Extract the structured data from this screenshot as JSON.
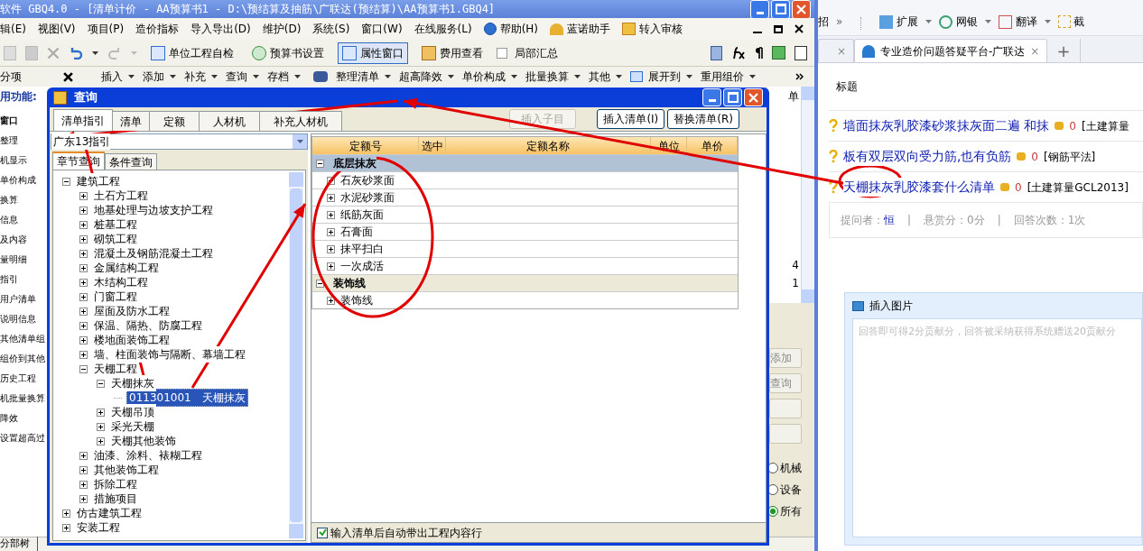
{
  "app": {
    "title": "软件 GBQ4.0 - [清单计价 - AA预算书1 - D:\\预结算及抽筋\\广联达(预结算)\\AA预算书1.GBQ4]",
    "menu": [
      "辑(E)",
      "视图(V)",
      "项目(P)",
      "造价指标",
      "导入导出(D)",
      "维护(D)",
      "系统(S)",
      "窗口(W)",
      "在线服务(L)",
      "帮助(H)",
      "蓝诺助手",
      "转入审核"
    ],
    "toolbar": [
      {
        "kind": "button",
        "label": "单位工程自检",
        "pressed": false
      },
      {
        "kind": "button",
        "label": "预算书设置",
        "pressed": false
      },
      {
        "kind": "button",
        "label": "属性窗口",
        "pressed": true
      },
      {
        "kind": "button",
        "label": "费用查看",
        "pressed": false
      },
      {
        "kind": "checkbox",
        "label": "局部汇总",
        "checked": false
      }
    ],
    "panel_tab": "分项",
    "toolbar2": [
      "插入",
      "添加",
      "补充",
      "查询",
      "存档",
      "整理清单",
      "超高降效",
      "单价构成",
      "批量换算",
      "其他",
      "展开到",
      "重用组价"
    ],
    "sidebar": {
      "heading": "用功能:",
      "items": [
        {
          "label": "窗口",
          "bold": true
        },
        {
          "label": "整理",
          "bold": false
        },
        {
          "label": "机显示",
          "bold": false
        },
        {
          "label": "单价构成",
          "bold": false
        },
        {
          "label": "换算",
          "bold": false
        },
        {
          "label": "信息",
          "bold": false
        },
        {
          "label": "及内容",
          "bold": false
        },
        {
          "label": "量明细",
          "bold": false
        },
        {
          "label": "指引",
          "bold": false
        },
        {
          "label": "用户清单",
          "bold": false
        },
        {
          "label": "说明信息",
          "bold": false
        },
        {
          "label": "其他清单组",
          "bold": false
        },
        {
          "label": "组价到其他",
          "bold": false
        },
        {
          "label": "历史工程",
          "bold": false
        },
        {
          "label": "机批量换算",
          "bold": false
        },
        {
          "label": "降效",
          "bold": false
        },
        {
          "label": "设置超高过",
          "bold": false
        }
      ]
    },
    "right_strip": {
      "column_header": "单",
      "values": [
        "4",
        "1"
      ],
      "buttons": [
        "添加",
        "查询"
      ],
      "radios": [
        {
          "label": "机械",
          "selected": false
        },
        {
          "label": "设备",
          "selected": false
        },
        {
          "label": "所有",
          "selected": true
        }
      ]
    },
    "bottom_tab": "分部树"
  },
  "dialog": {
    "title": "查询",
    "tabs": [
      {
        "label": "清单指引",
        "selected": true
      },
      {
        "label": "清单",
        "selected": false
      },
      {
        "label": "定额",
        "selected": false
      },
      {
        "label": "人材机",
        "selected": false
      },
      {
        "label": "补充人材机",
        "selected": false
      }
    ],
    "buttons": [
      {
        "label": "插入子目",
        "disabled": true
      },
      {
        "label": "插入清单(I)",
        "disabled": false
      },
      {
        "label": "替换清单(R)",
        "disabled": false
      }
    ],
    "library": "广东13指引",
    "subtabs": [
      {
        "label": "章节查询",
        "selected": true
      },
      {
        "label": "条件查询",
        "selected": false
      }
    ],
    "tree": [
      {
        "label": "建筑工程",
        "expanded": true,
        "children": [
          {
            "label": "土石方工程",
            "expanded": false
          },
          {
            "label": "地基处理与边坡支护工程",
            "expanded": false
          },
          {
            "label": "桩基工程",
            "expanded": false
          },
          {
            "label": "砌筑工程",
            "expanded": false
          },
          {
            "label": "混凝土及钢筋混凝土工程",
            "expanded": false
          },
          {
            "label": "金属结构工程",
            "expanded": false
          },
          {
            "label": "木结构工程",
            "expanded": false
          },
          {
            "label": "门窗工程",
            "expanded": false
          },
          {
            "label": "屋面及防水工程",
            "expanded": false
          },
          {
            "label": "保温、隔热、防腐工程",
            "expanded": false
          },
          {
            "label": "楼地面装饰工程",
            "expanded": false
          },
          {
            "label": "墙、柱面装饰与隔断、幕墙工程",
            "expanded": false
          },
          {
            "label": "天棚工程",
            "expanded": true,
            "children": [
              {
                "label": "天棚抹灰",
                "expanded": true,
                "children": [
                  {
                    "label": "011301001　天棚抹灰",
                    "selected": true
                  }
                ]
              },
              {
                "label": "天棚吊顶",
                "expanded": false
              },
              {
                "label": "采光天棚",
                "expanded": false
              },
              {
                "label": "天棚其他装饰",
                "expanded": false
              }
            ]
          },
          {
            "label": "油漆、涂料、裱糊工程",
            "expanded": false
          },
          {
            "label": "其他装饰工程",
            "expanded": false
          },
          {
            "label": "拆除工程",
            "expanded": false
          },
          {
            "label": "措施项目",
            "expanded": false
          }
        ]
      },
      {
        "label": "仿古建筑工程",
        "expanded": false
      },
      {
        "label": "安装工程",
        "expanded": false
      }
    ],
    "table": {
      "columns": [
        "定额号",
        "选中",
        "定额名称",
        "单位",
        "单价"
      ],
      "groups": [
        {
          "label": "底层抹灰",
          "expanded": true,
          "selected": true,
          "rows": [
            "石灰砂浆面",
            "水泥砂浆面",
            "纸筋灰面",
            "石膏面",
            "抹平扫白",
            "一次成活"
          ]
        },
        {
          "label": "装饰线",
          "expanded": true,
          "selected": false,
          "rows": [
            "装饰线"
          ]
        }
      ]
    },
    "auto_content": {
      "label": "输入清单后自动带出工程内容行",
      "checked": true
    }
  },
  "browser": {
    "toolbar": {
      "lead": "招",
      "more": "»",
      "items": [
        "扩展",
        "网银",
        "翻译"
      ],
      "cut_item": "截"
    },
    "tabs": [
      {
        "selected": false,
        "close": "×"
      },
      {
        "title": "专业造价问题答疑平台-广联达",
        "selected": true,
        "close": "×"
      }
    ],
    "new_tab": "+",
    "heading": "标题",
    "questions": [
      {
        "title": "墙面抹灰乳胶漆砂浆抹灰面二遍 和抹",
        "points": "0",
        "tag": "[土建算量"
      },
      {
        "title": "板有双层双向受力筋,也有负筋",
        "points": "0",
        "tag": "[钢筋平法]"
      },
      {
        "title": "天棚抹灰乳胶漆套什么清单",
        "points": "0",
        "tag": "[土建算量GCL2013]"
      }
    ],
    "meta": [
      {
        "kind": "field",
        "label": "提问者：",
        "value": "恒"
      },
      {
        "kind": "separator",
        "text": "|"
      },
      {
        "kind": "text",
        "text": "悬赏分：0分"
      },
      {
        "kind": "separator",
        "text": "|"
      },
      {
        "kind": "text",
        "text": "回答次数：1次"
      }
    ],
    "editor": {
      "tool": "插入图片",
      "placeholder": "回答即可得2分贡献分，回答被采纳获得系统赠送20贡献分"
    }
  }
}
